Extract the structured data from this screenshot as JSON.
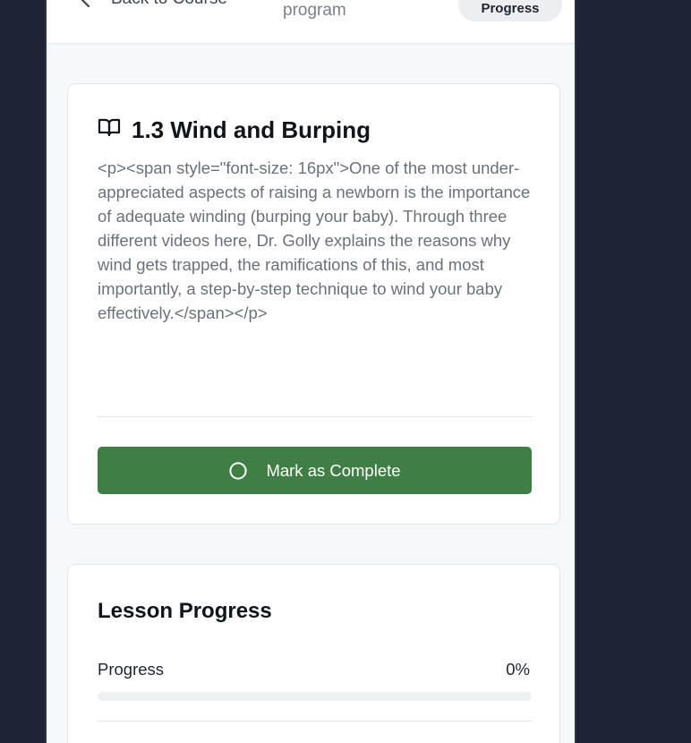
{
  "header": {
    "back_label": "Back to Course",
    "course_subtitle": "program",
    "progress_pill": "Progress"
  },
  "lesson": {
    "title": "1.3 Wind and Burping",
    "body": "<p><span style=\"font-size: 16px\">One of the most under-appreciated aspects of raising a newborn is the importance of adequate winding (burping your baby). Through three different videos here, Dr. Golly explains the reasons why wind gets trapped, the ramifications of this, and most importantly, a step-by-step technique to wind your baby effectively.</span></p>",
    "complete_button": "Mark as Complete"
  },
  "lesson_progress": {
    "heading": "Lesson Progress",
    "label": "Progress",
    "value_text": "0%",
    "fraction": 0
  },
  "colors": {
    "accent_green": "#3f7f45",
    "page_background": "#1e2433"
  },
  "icons": {
    "back": "chevron-left-icon",
    "lesson": "book-open-icon",
    "complete": "circle-icon"
  }
}
